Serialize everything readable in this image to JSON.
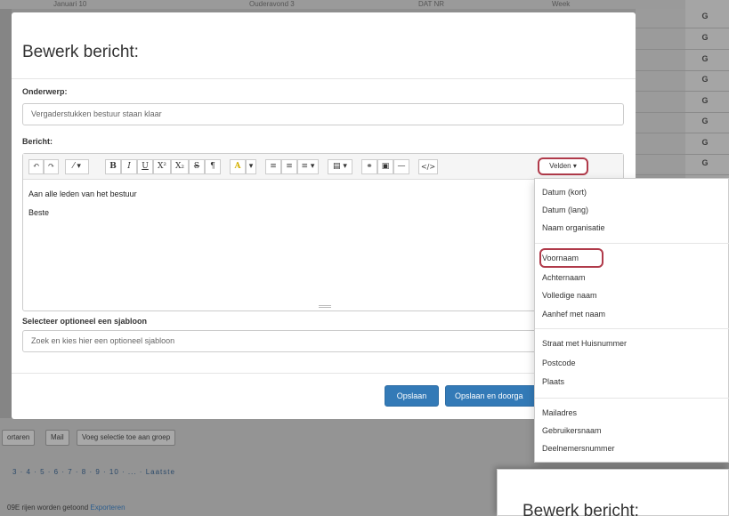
{
  "modal": {
    "title": "Bewerk bericht:",
    "subject_label": "Onderwerp:",
    "subject_value": "Vergaderstukken bestuur staan klaar",
    "message_label": "Bericht:",
    "editor_lines": [
      "Aan alle leden van het bestuur",
      "Beste"
    ],
    "template_label": "Selecteer optioneel een sjabloon",
    "template_placeholder": "Zoek en kies hier een optioneel sjabloon",
    "save_label": "Opslaan",
    "save_continue_label": "Opslaan en doorga"
  },
  "toolbar": {
    "variabel_label": "Velden ▾",
    "buttons": [
      "↶",
      "↷",
      "⁄ ▾",
      "B",
      "I",
      "U",
      "X²",
      "X₂",
      "S",
      "¶",
      "A",
      "▾",
      "≡",
      "≡",
      "≡ ▾",
      "▤ ▾",
      "⚭",
      "▣",
      "—",
      "</>"
    ]
  },
  "dropdown": {
    "groups": [
      [
        "Datum (kort)",
        "Datum (lang)",
        "Naam organisatie"
      ],
      [
        "Voornaam",
        "Achternaam",
        "Volledige naam",
        "Aanhef met naam"
      ],
      [
        "Straat met Huisnummer",
        "Postcode",
        "Plaats"
      ],
      [
        "Mailadres",
        "Gebruikersnaam",
        "Deelnemersnummer"
      ]
    ]
  },
  "background": {
    "top_cells": [
      "Januari 10",
      "Ouderavond 3",
      "DAT NR",
      "Week"
    ],
    "row_letter": "G",
    "buttons": [
      "ortaren",
      "Mail",
      "Voeg selectie toe aan groep"
    ],
    "pager": "3 · 4 · 5 · 6 · 7 · 8 · 9 · 10 · ... · Laatste",
    "footer_text": "09E rijen worden getoond",
    "footer_link": "Exporteren"
  },
  "inset": {
    "title": "Bewerk bericht:"
  },
  "colors": {
    "primary": "#337ab7",
    "highlight_border": "#b03a4a"
  }
}
